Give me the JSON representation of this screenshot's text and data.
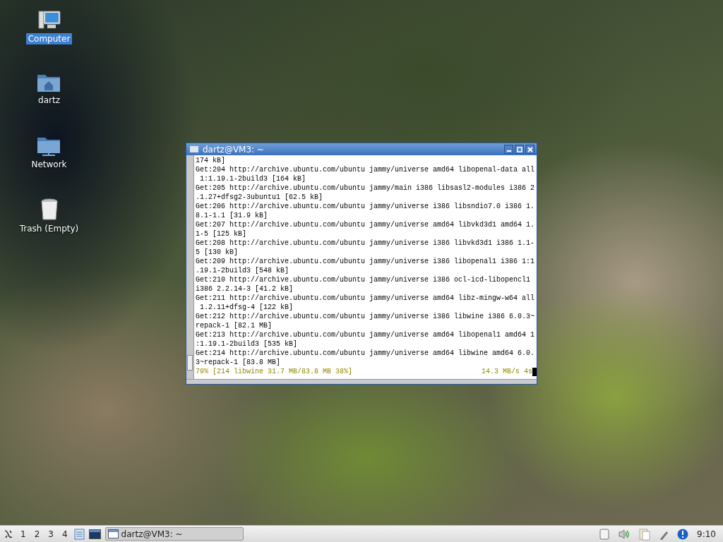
{
  "desktop_icons": [
    {
      "kind": "computer",
      "label": "Computer",
      "selected": true
    },
    {
      "kind": "home",
      "label": "dartz",
      "selected": false
    },
    {
      "kind": "network",
      "label": "Network",
      "selected": false
    },
    {
      "kind": "trash",
      "label": "Trash (Empty)",
      "selected": false
    }
  ],
  "terminal": {
    "title": "dartz@VM3: ~",
    "lines": [
      "174 kB]",
      "Get:204 http://archive.ubuntu.com/ubuntu jammy/universe amd64 libopenal-data all",
      " 1:1.19.1-2build3 [164 kB]",
      "Get:205 http://archive.ubuntu.com/ubuntu jammy/main i386 libsasl2-modules i386 2",
      ".1.27+dfsg2-3ubuntu1 [62.5 kB]",
      "Get:206 http://archive.ubuntu.com/ubuntu jammy/universe i386 libsndio7.0 i386 1.",
      "8.1-1.1 [31.9 kB]",
      "Get:207 http://archive.ubuntu.com/ubuntu jammy/universe amd64 libvkd3d1 amd64 1.",
      "1-5 [125 kB]",
      "Get:208 http://archive.ubuntu.com/ubuntu jammy/universe i386 libvkd3d1 i386 1.1-",
      "5 [130 kB]",
      "Get:209 http://archive.ubuntu.com/ubuntu jammy/universe i386 libopenal1 i386 1:1",
      ".19.1-2build3 [548 kB]",
      "Get:210 http://archive.ubuntu.com/ubuntu jammy/universe i386 ocl-icd-libopencl1",
      "i386 2.2.14-3 [41.2 kB]",
      "Get:211 http://archive.ubuntu.com/ubuntu jammy/universe amd64 libz-mingw-w64 all",
      " 1.2.11+dfsg-4 [122 kB]",
      "Get:212 http://archive.ubuntu.com/ubuntu jammy/universe i386 libwine i386 6.0.3~",
      "repack-1 [82.1 MB]",
      "Get:213 http://archive.ubuntu.com/ubuntu jammy/universe amd64 libopenal1 amd64 1",
      ":1.19.1-2build3 [535 kB]",
      "Get:214 http://archive.ubuntu.com/ubuntu jammy/universe amd64 libwine amd64 6.0.",
      "3~repack-1 [83.8 MB]"
    ],
    "status_left": "79% [214 libwine 31.7 MB/83.8 MB 38%]",
    "status_right": "14.3 MB/s 4s"
  },
  "taskbar": {
    "workspaces": [
      "1",
      "2",
      "3",
      "4"
    ],
    "task": "dartz@VM3: ~",
    "clock": "9:10"
  }
}
